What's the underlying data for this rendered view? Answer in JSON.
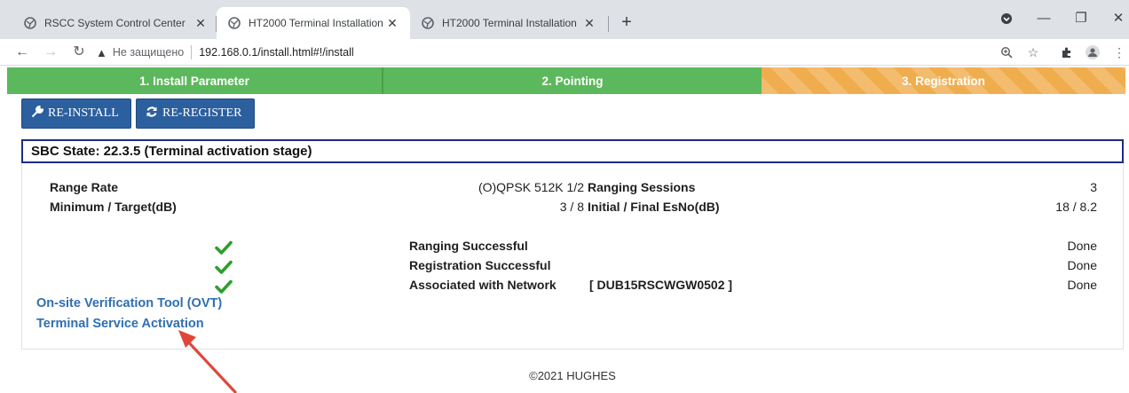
{
  "browser": {
    "tabs": [
      {
        "title": "RSCC System Control Center"
      },
      {
        "title": "HT2000 Terminal Installation"
      },
      {
        "title": "HT2000 Terminal Installation"
      }
    ],
    "tab_close": "✕",
    "new_tab": "+",
    "window_controls": {
      "minimize": "—",
      "restore": "❐",
      "close": "✕"
    },
    "address": {
      "security_label": "Не защищено",
      "url": "192.168.0.1/install.html#!/install"
    }
  },
  "steps": [
    {
      "label": "1. Install Parameter",
      "state": "done"
    },
    {
      "label": "2. Pointing",
      "state": "done"
    },
    {
      "label": "3. Registration",
      "state": "active"
    }
  ],
  "actions": {
    "reinstall_label": "RE-INSTALL",
    "reregister_label": "RE-REGISTER"
  },
  "sbc_state": "SBC State: 22.3.5 (Terminal activation stage)",
  "params": {
    "range_rate_label": "Range Rate",
    "range_rate_value": "(O)QPSK 512K 1/2",
    "ranging_sessions_label": "Ranging Sessions",
    "ranging_sessions_value": "3",
    "min_target_label": "Minimum / Target(dB)",
    "min_target_value": "3 / 8",
    "esno_label": "Initial / Final EsNo(dB)",
    "esno_value": "18 / 8.2"
  },
  "status_rows": [
    {
      "label": "Ranging Successful",
      "extra": "",
      "status": "Done"
    },
    {
      "label": "Registration Successful",
      "extra": "",
      "status": "Done"
    },
    {
      "label": "Associated with Network",
      "extra": "[ DUB15RSCWGW0502 ]",
      "status": "Done"
    }
  ],
  "links": {
    "ovt": "On-site Verification Tool (OVT)",
    "activation": "Terminal Service Activation"
  },
  "footer": "©2021 HUGHES",
  "colors": {
    "step_done": "#5cb85c",
    "step_active": "#f0ad4e",
    "button": "#2c5f9e",
    "link": "#2f6fb0",
    "check": "#2e9e2e",
    "annotation_arrow": "#e0463a"
  }
}
